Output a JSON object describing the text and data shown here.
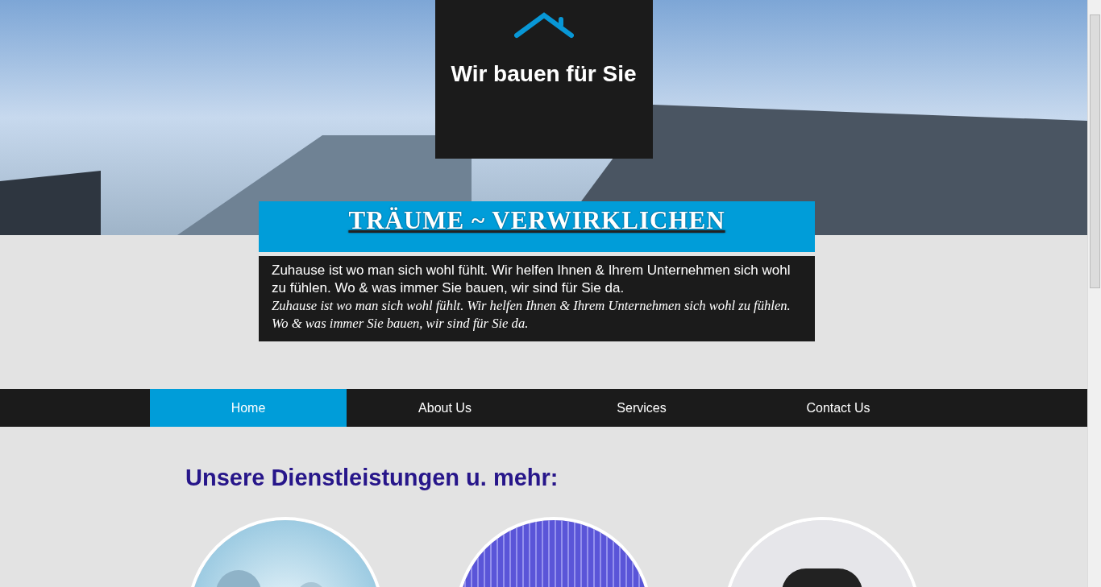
{
  "header": {
    "title": "Wir bauen für Sie"
  },
  "banner": {
    "tagline": "TRÄUME ~ VERWIRKLICHEN"
  },
  "intro": {
    "text": "Zuhause ist wo man sich wohl fühlt. Wir helfen Ihnen & Ihrem Unternehmen sich wohl zu fühlen. Wo & was immer Sie bauen, wir sind für Sie da.",
    "text_italic": "Zuhause ist wo man sich wohl fühlt. Wir helfen Ihnen & Ihrem Unternehmen sich wohl zu fühlen. Wo & was immer Sie bauen, wir sind für Sie da."
  },
  "nav": [
    {
      "label": "Home",
      "selected": true
    },
    {
      "label": "About Us",
      "selected": false
    },
    {
      "label": "Services",
      "selected": false
    },
    {
      "label": "Contact Us",
      "selected": false
    }
  ],
  "services": {
    "heading": "Unsere Dienstleistungen u. mehr:",
    "images": [
      {
        "kind": "gears"
      },
      {
        "kind": "grid"
      },
      {
        "kind": "device"
      }
    ]
  }
}
